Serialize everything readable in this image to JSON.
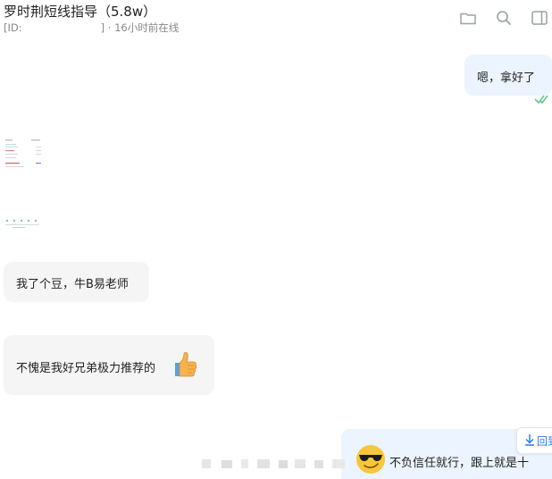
{
  "header": {
    "title": "罗时荆短线指导（5.8w）",
    "id_prefix": "[ID:",
    "id_suffix": "] · 16小时前在线",
    "icons": [
      "folder-icon",
      "search-icon",
      "sidebar-toggle-icon"
    ]
  },
  "messages": [
    {
      "direction": "out",
      "text": "嗯，拿好了",
      "status": "read-double-check"
    },
    {
      "direction": "in",
      "type": "image",
      "alt": "screenshot-thumbnail"
    },
    {
      "direction": "in",
      "type": "image",
      "alt": "screenshot-thumbnail-small"
    },
    {
      "direction": "in",
      "text": "我了个豆，牛B易老师"
    },
    {
      "direction": "in",
      "text": "不愧是我好兄弟极力推荐的",
      "emoji": "thumbs-up-emoji"
    },
    {
      "direction": "out",
      "text": "不负信任就行，跟上就是十",
      "emoji": "sunglasses-emoji"
    }
  ],
  "download": {
    "label": "回到"
  },
  "colors": {
    "outgoing_bubble": "#ebf4ff",
    "incoming_bubble": "#f5f5f5",
    "check": "#4cc27a",
    "link": "#2b7de9"
  }
}
